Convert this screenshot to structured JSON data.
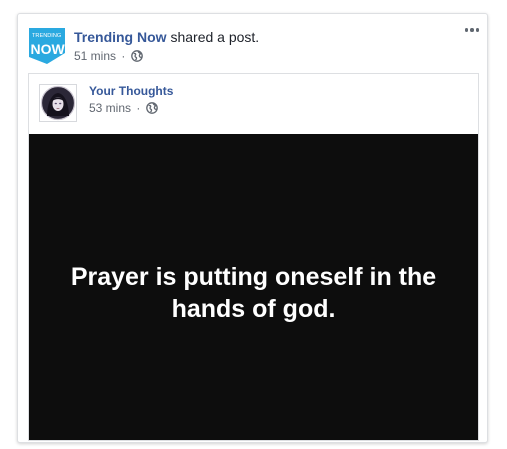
{
  "post": {
    "page_name": "Trending Now",
    "action_text": "shared a post.",
    "timestamp": "51 mins",
    "separator": "·",
    "privacy_icon": "globe-icon",
    "menu_icon": "more-options-icon",
    "logo": {
      "top_text": "TRENDING",
      "main_text": "NOW",
      "color": "#2aa9e0"
    }
  },
  "shared_post": {
    "author": "Your Thoughts",
    "timestamp": "53 mins",
    "separator": "·",
    "privacy_icon": "globe-icon",
    "image_text": "Prayer is putting oneself in the hands of god."
  },
  "colors": {
    "link": "#365899",
    "meta": "#616770",
    "image_bg": "#0d0d0d"
  }
}
